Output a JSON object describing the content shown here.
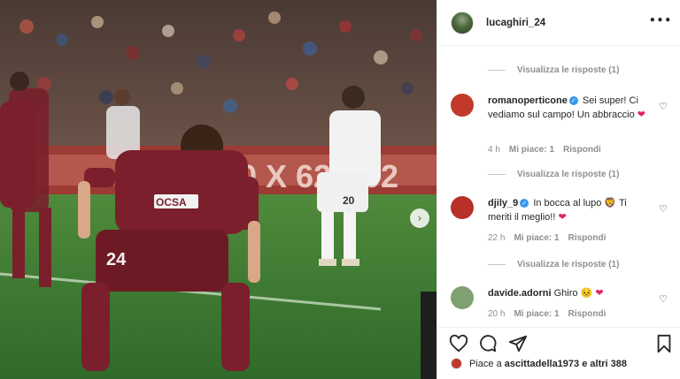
{
  "post": {
    "username": "lucaghiri_24",
    "more_icon": "more-horizontal-icon",
    "shirt_number": "24",
    "sponsor": "OCSA",
    "opponent_number": "20",
    "board_text": "40 X 62",
    "board_text_right": "02"
  },
  "comments": [
    {
      "user": "romanoperticone",
      "verified": true,
      "text": "Sei super! Ci vediamo sul campo! Un abbraccio",
      "emoji": "❤",
      "time": "4 h",
      "likes": "Mi piace: 1",
      "reply": "Rispondi",
      "avatar_color": "#c0392b"
    },
    {
      "user": "djily_9",
      "verified": true,
      "text": "In bocca al lupo 🦁 Ti meriti il meglio!!",
      "emoji": "❤",
      "time": "22 h",
      "likes": "Mi piace: 1",
      "reply": "Rispondi",
      "avatar_color": "#b8302a"
    },
    {
      "user": "davide.adorni",
      "verified": false,
      "text": "Ghiro 😣",
      "emoji": "❤",
      "time": "20 h",
      "likes": "Mi piace: 1",
      "reply": "Rispondi",
      "avatar_color": "#7fa070"
    }
  ],
  "view_replies": [
    "Visualizza le risposte (1)",
    "Visualizza le risposte (1)",
    "Visualizza le risposte (1)"
  ],
  "actions": {
    "like_icon": "heart-outline-icon",
    "comment_icon": "comment-icon",
    "share_icon": "share-icon",
    "save_icon": "bookmark-icon"
  },
  "liked_by": {
    "prefix": "Piace a",
    "user": "ascittadella1973",
    "suffix": "e altri 388"
  },
  "colors": {
    "link": "#3897f0",
    "muted": "#8e8e8e",
    "heart": "#e0245e",
    "cittadella": "#7a1f2b"
  }
}
